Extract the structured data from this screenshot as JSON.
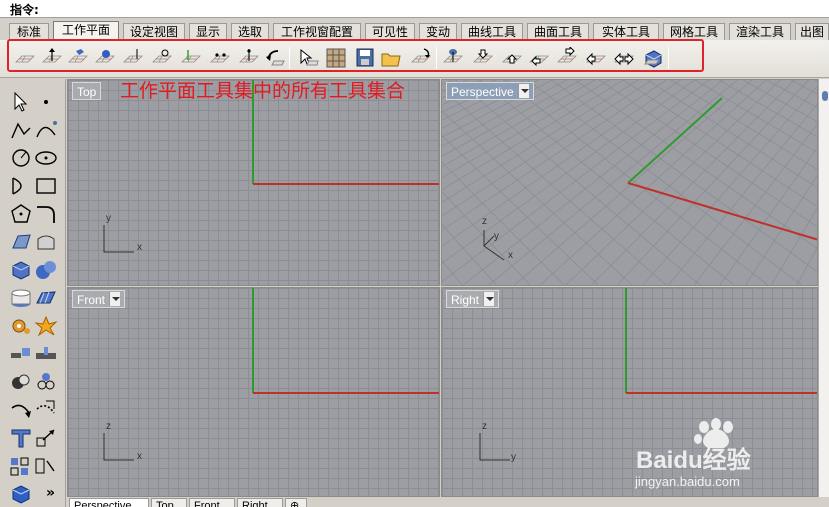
{
  "command": {
    "label": "指令:"
  },
  "tabs": [
    {
      "label": "标准"
    },
    {
      "label": "工作平面",
      "active": true
    },
    {
      "label": "设定视图"
    },
    {
      "label": "显示"
    },
    {
      "label": "选取"
    },
    {
      "label": "工作视窗配置"
    },
    {
      "label": "可见性"
    },
    {
      "label": "变动"
    },
    {
      "label": "曲线工具"
    },
    {
      "label": "曲面工具"
    },
    {
      "label": "实体工具"
    },
    {
      "label": "网格工具"
    },
    {
      "label": "渲染工具"
    },
    {
      "label": "出图"
    }
  ],
  "annotation": {
    "text": "工作平面工具集中的所有工具集合"
  },
  "viewports": {
    "top": {
      "title": "Top",
      "axis_x": "x",
      "axis_y": "y"
    },
    "perspective": {
      "title": "Perspective",
      "axis_x": "x",
      "axis_y": "y",
      "axis_z": "z"
    },
    "front": {
      "title": "Front",
      "axis_x": "x",
      "axis_z": "z"
    },
    "right": {
      "title": "Right",
      "axis_y": "y",
      "axis_z": "z"
    }
  },
  "bottom_tabs": [
    {
      "label": "Perspective",
      "active": true
    },
    {
      "label": "Top"
    },
    {
      "label": "Front"
    },
    {
      "label": "Right"
    },
    {
      "label": "⊕"
    }
  ],
  "palette": {
    "more_label": "»"
  },
  "watermark": {
    "brand": "Baidu经验",
    "url": "jingyan.baidu.com"
  },
  "colors": {
    "x_axis": "#c0302a",
    "y_axis": "#2f9a2f",
    "highlight": "#e0232a"
  },
  "toolbar_icons": [
    "set-cplane-origin-icon",
    "set-cplane-elevation-icon",
    "set-cplane-to-object-icon",
    "set-cplane-to-surface-icon",
    "set-cplane-perpendicular-icon",
    "set-cplane-3-points-icon",
    "set-cplane-x-axis-icon",
    "set-cplane-z-axis-icon",
    "set-cplane-vertical-icon",
    "undo-cplane-icon",
    "set-cplane-to-view-icon",
    "named-cplanes-icon",
    "save-cplane-icon",
    "open-cplane-icon",
    "rotate-cplane-icon",
    "cplane-world-top-icon",
    "cplane-world-bottom-icon",
    "cplane-world-front-icon",
    "cplane-world-back-icon",
    "cplane-world-left-icon",
    "cplane-world-right-icon",
    "cplane-through-icon",
    "cplane-world-3d-icon"
  ]
}
